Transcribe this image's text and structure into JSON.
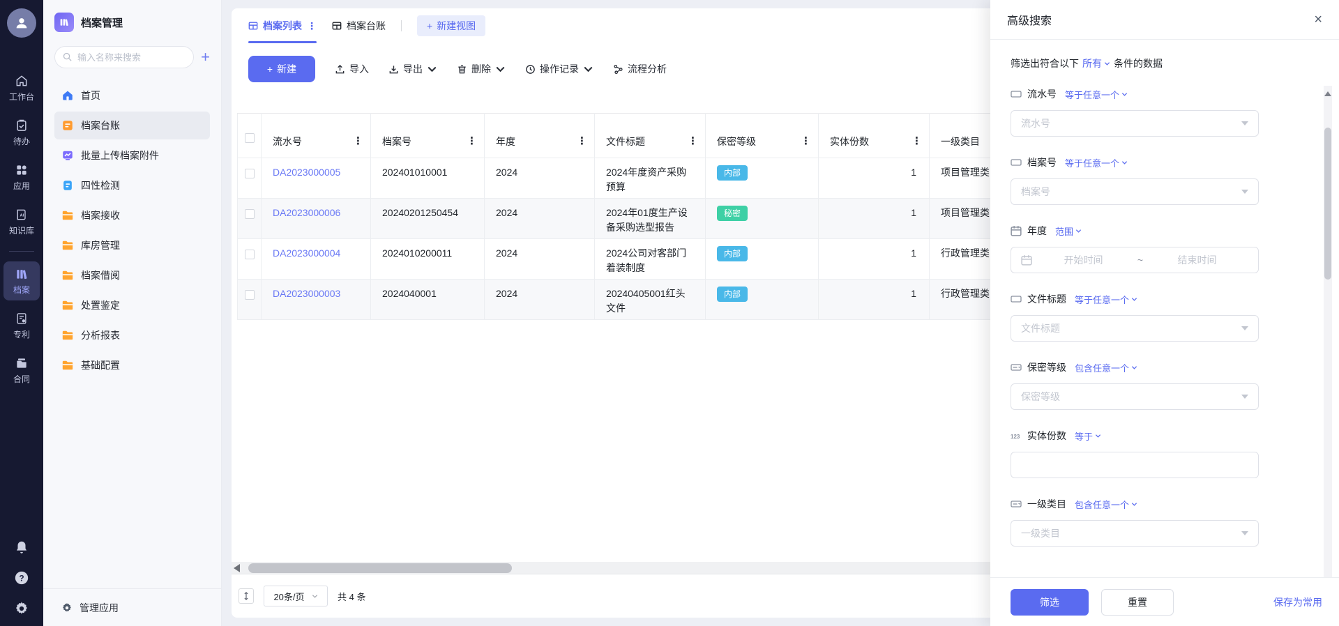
{
  "theme": {
    "accent": "#5a6bf0",
    "rail_bg": "#161931",
    "link": "#6a79f5",
    "badge_internal": "#49b8e8",
    "badge_secret": "#3ed0a5"
  },
  "rail": {
    "items": [
      {
        "label": "工作台"
      },
      {
        "label": "待办"
      },
      {
        "label": "应用"
      },
      {
        "label": "知识库"
      },
      {
        "label": "档案"
      },
      {
        "label": "专利"
      },
      {
        "label": "合同"
      }
    ]
  },
  "sidebar": {
    "app_title": "档案管理",
    "search_placeholder": "输入名称来搜索",
    "items": [
      {
        "label": "首页"
      },
      {
        "label": "档案台账"
      },
      {
        "label": "批量上传档案附件"
      },
      {
        "label": "四性检测"
      },
      {
        "label": "档案接收"
      },
      {
        "label": "库房管理"
      },
      {
        "label": "档案借阅"
      },
      {
        "label": "处置鉴定"
      },
      {
        "label": "分析报表"
      },
      {
        "label": "基础配置"
      }
    ],
    "footer_label": "管理应用"
  },
  "tabs": {
    "tab1": "档案列表",
    "tab2": "档案台账",
    "new_view": "新建视图"
  },
  "toolbar": {
    "new": "新建",
    "import": "导入",
    "export": "导出",
    "delete": "删除",
    "op_log": "操作记录",
    "flow": "流程分析"
  },
  "table": {
    "columns": [
      "流水号",
      "档案号",
      "年度",
      "文件标题",
      "保密等级",
      "实体份数",
      "一级类目"
    ],
    "rows": [
      {
        "serial": "DA2023000005",
        "archive_no": "202401010001",
        "year": "2024",
        "title": "2024年度资产采购预算",
        "level": "内部",
        "copies": "1",
        "category": "项目管理类"
      },
      {
        "serial": "DA2023000006",
        "archive_no": "20240201250454",
        "year": "2024",
        "title": "2024年01度生产设备采购选型报告",
        "level": "秘密",
        "copies": "1",
        "category": "项目管理类"
      },
      {
        "serial": "DA2023000004",
        "archive_no": "2024010200011",
        "year": "2024",
        "title": "2024公司对客部门着装制度",
        "level": "内部",
        "copies": "1",
        "category": "行政管理类"
      },
      {
        "serial": "DA2023000003",
        "archive_no": "2024040001",
        "year": "2024",
        "title": "20240405001红头文件",
        "level": "内部",
        "copies": "1",
        "category": "行政管理类"
      }
    ]
  },
  "pagination": {
    "page_size": "20条/页",
    "total": "共 4 条"
  },
  "panel": {
    "title": "高级搜索",
    "close": "×",
    "intro_prefix": "筛选出符合以下",
    "intro_mode": "所有",
    "intro_suffix": "条件的数据",
    "fields": [
      {
        "label": "流水号",
        "op": "等于任意一个",
        "placeholder": "流水号"
      },
      {
        "label": "档案号",
        "op": "等于任意一个",
        "placeholder": "档案号"
      },
      {
        "label": "年度",
        "op": "范围",
        "start_placeholder": "开始时间",
        "separator": "~",
        "end_placeholder": "结束时间"
      },
      {
        "label": "文件标题",
        "op": "等于任意一个",
        "placeholder": "文件标题"
      },
      {
        "label": "保密等级",
        "op": "包含任意一个",
        "placeholder": "保密等级"
      },
      {
        "label": "实体份数",
        "op": "等于",
        "placeholder": ""
      },
      {
        "label": "一级类目",
        "op": "包含任意一个",
        "placeholder": "一级类目"
      }
    ],
    "footer": {
      "filter": "筛选",
      "reset": "重置",
      "save": "保存为常用"
    }
  }
}
